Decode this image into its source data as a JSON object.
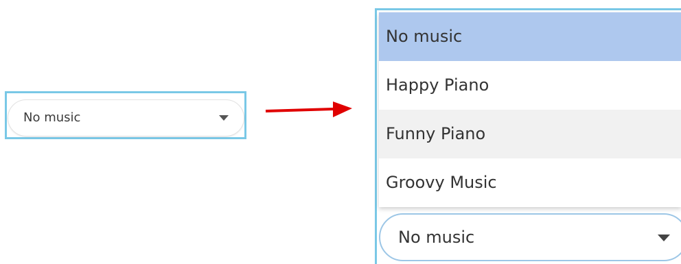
{
  "collapsed_select": {
    "value": "No music",
    "caret_icon": "caret-down-icon"
  },
  "arrow": {
    "icon": "right-arrow-icon",
    "color": "#e00000"
  },
  "expanded_select": {
    "value": "No music",
    "caret_icon": "caret-down-icon",
    "options": [
      {
        "label": "No music",
        "selected": true
      },
      {
        "label": "Happy Piano",
        "selected": false
      },
      {
        "label": "Funny Piano",
        "selected": false
      },
      {
        "label": "Groovy Music",
        "selected": false
      }
    ]
  },
  "colors": {
    "highlight_frame": "#79c8e6",
    "selected_option": "#aec8ee",
    "alternate_option": "#f1f1f1"
  }
}
